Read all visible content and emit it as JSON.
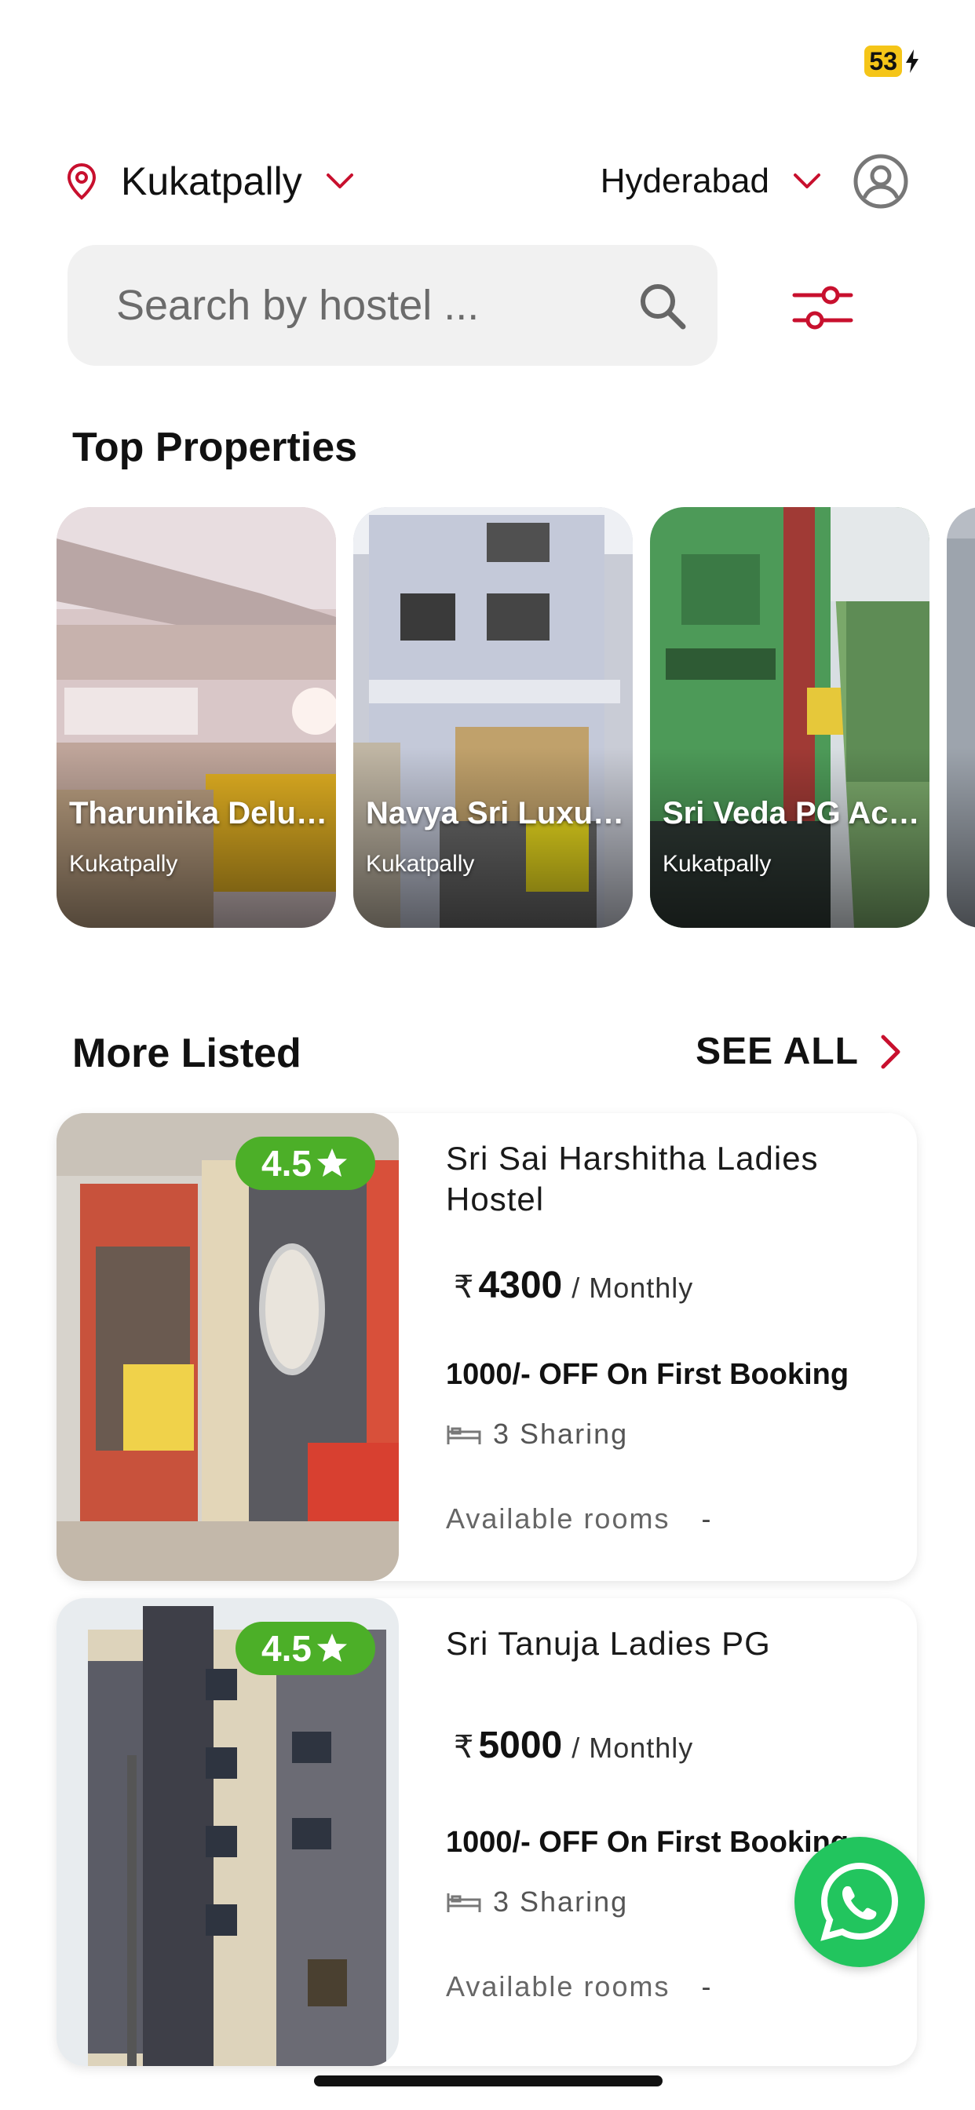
{
  "status": {
    "battery": "53"
  },
  "location": {
    "area": "Kukatpally",
    "city": "Hyderabad"
  },
  "search": {
    "placeholder": "Search by hostel ..."
  },
  "sections": {
    "top_properties": "Top Properties",
    "more_listed": "More Listed",
    "see_all": "SEE ALL"
  },
  "top_properties": [
    {
      "name": "Tharunika Deluxe...",
      "area": "Kukatpally"
    },
    {
      "name": "Navya Sri Luxury...",
      "area": "Kukatpally"
    },
    {
      "name": "Sri Veda PG Acco...",
      "area": "Kukatpally"
    }
  ],
  "listings": [
    {
      "rating": "4.5",
      "name": "Sri Sai Harshitha Ladies Hostel",
      "currency": "₹",
      "price": "4300",
      "period": "/ Monthly",
      "offer": "1000/- OFF On First Booking",
      "sharing": "3 Sharing",
      "rooms_label": "Available rooms",
      "rooms_value": "-"
    },
    {
      "rating": "4.5",
      "name": "Sri Tanuja Ladies PG",
      "currency": "₹",
      "price": "5000",
      "period": "/ Monthly",
      "offer": "1000/- OFF On First Booking",
      "sharing": "3 Sharing",
      "rooms_label": "Available rooms",
      "rooms_value": "-"
    }
  ],
  "colors": {
    "accent": "#c8102e",
    "rating_green": "#4caf28",
    "whatsapp_green": "#22c55e",
    "search_bg": "#f1f1f1"
  },
  "icons": [
    "location-pin-icon",
    "chevron-down-icon",
    "user-avatar-icon",
    "search-icon",
    "filter-sliders-icon",
    "chevron-right-icon",
    "star-icon",
    "bed-icon",
    "whatsapp-icon",
    "battery-bolt-icon"
  ]
}
